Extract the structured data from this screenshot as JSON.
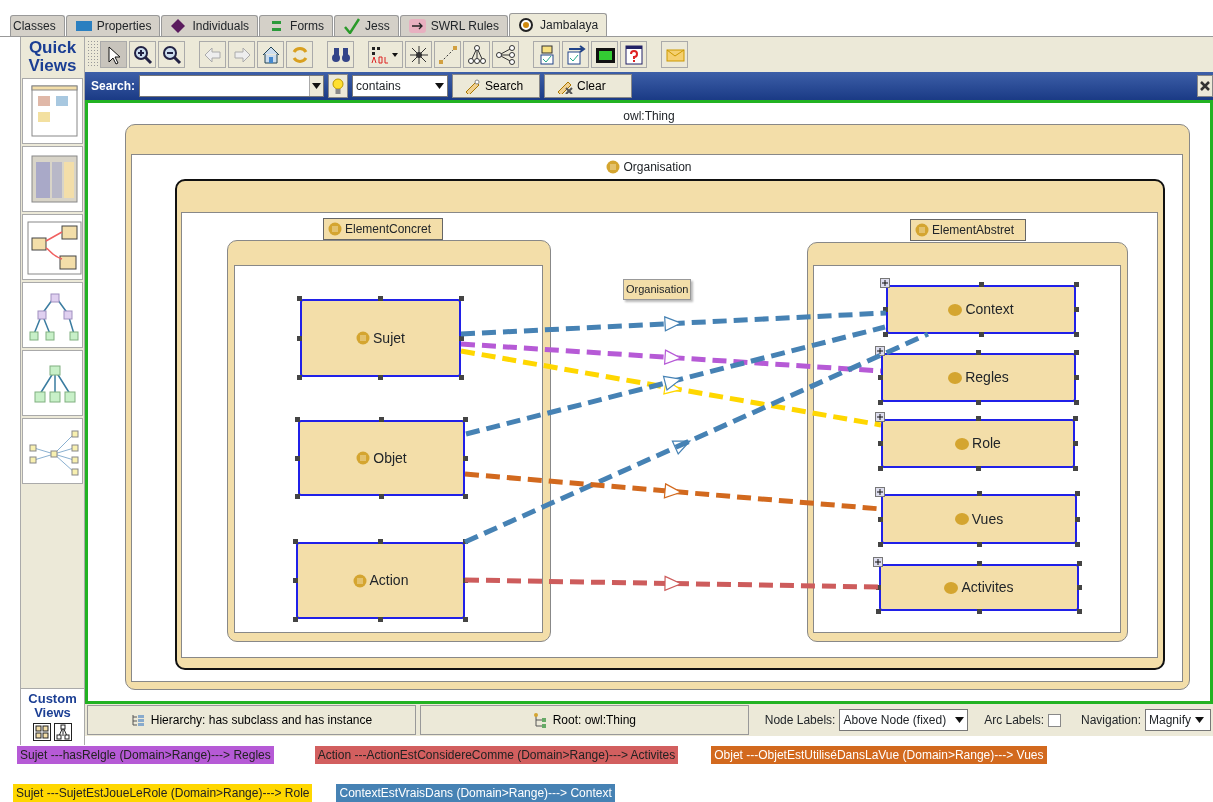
{
  "tabs": [
    {
      "label": "Classes",
      "selected": false
    },
    {
      "label": "Properties",
      "selected": false
    },
    {
      "label": "Individuals",
      "selected": false
    },
    {
      "label": "Forms",
      "selected": false
    },
    {
      "label": "Jess",
      "selected": false
    },
    {
      "label": "SWRL Rules",
      "selected": false
    },
    {
      "label": "Jambalaya",
      "selected": true
    }
  ],
  "quick_views": {
    "title": "Quick Views"
  },
  "custom_views": {
    "title": "Custom Views"
  },
  "search": {
    "label": "Search:",
    "mode": "contains",
    "search_button": "Search",
    "clear_button": "Clear"
  },
  "diagram": {
    "root": "owl:Thing",
    "organisation": "Organisation",
    "tooltip": "Organisation",
    "groups": [
      {
        "label": "ElementConcret",
        "nodes": [
          {
            "label": "Sujet",
            "expandable": false
          },
          {
            "label": "Objet",
            "expandable": false
          },
          {
            "label": "Action",
            "expandable": false
          }
        ]
      },
      {
        "label": "ElementAbstret",
        "nodes": [
          {
            "label": "Context",
            "expandable": true
          },
          {
            "label": "Regles",
            "expandable": true
          },
          {
            "label": "Role",
            "expandable": true
          },
          {
            "label": "Vues",
            "expandable": true
          },
          {
            "label": "Activites",
            "expandable": true
          }
        ]
      }
    ],
    "edges": [
      {
        "color": "#4682b4"
      },
      {
        "color": "#b65ad6"
      },
      {
        "color": "#ffd700"
      },
      {
        "color": "#4682b4"
      },
      {
        "color": "#4682b4"
      },
      {
        "color": "#d2691e"
      },
      {
        "color": "#cd5c5c"
      }
    ]
  },
  "bottom_bar": {
    "hierarchy": "Hierarchy: has subclass and has instance",
    "root": "Root: owl:Thing",
    "node_labels_label": "Node Labels:",
    "node_labels": "Above Node (fixed)",
    "arc_labels_label": "Arc Labels:",
    "arc_labels_checked": false,
    "navigation_label": "Navigation:",
    "navigation": "Magnify"
  },
  "legend": [
    [
      {
        "text": "Sujet ---hasRelgle (Domain>Range)---> Regles",
        "color": "#b65ad6"
      },
      {
        "text": "Action ---ActionEstConsidereComme (Domain>Range)---> Activites",
        "color": "#d25f5f"
      },
      {
        "text": "Objet ---ObjetEstUtiliséDansLaVue (Domain>Range)---> Vues",
        "color": "#d2691e"
      }
    ],
    [
      {
        "text": "Sujet ---SujetEstJoueLeRole (Domain>Range)---> Role",
        "color": "#ffd700"
      },
      {
        "text": "ContextEstVraisDans (Domain>Range)---> Context",
        "color": "#4682b4"
      }
    ]
  ]
}
